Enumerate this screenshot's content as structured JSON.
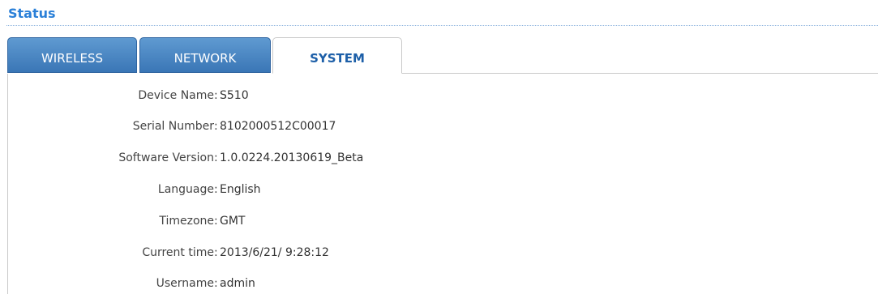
{
  "page": {
    "title": "Status"
  },
  "tabs": [
    {
      "label": "WIRELESS",
      "active": false
    },
    {
      "label": "NETWORK",
      "active": false
    },
    {
      "label": "SYSTEM",
      "active": true
    }
  ],
  "system_info": {
    "separator": ":",
    "rows": [
      {
        "label": "Device Name",
        "value": "S510"
      },
      {
        "label": "Serial Number",
        "value": "8102000512C00017"
      },
      {
        "label": "Software Version",
        "value": "1.0.0224.20130619_Beta"
      },
      {
        "label": "Language",
        "value": "English"
      },
      {
        "label": "Timezone",
        "value": "GMT"
      },
      {
        "label": "Current time",
        "value": "2013/6/21/ 9:28:12"
      },
      {
        "label": "Username",
        "value": "admin"
      }
    ]
  },
  "colors": {
    "title": "#2b80d8",
    "tab_inactive": "#4a86c5",
    "tab_active_text": "#1d5fa8",
    "border": "#c9c9c9"
  }
}
